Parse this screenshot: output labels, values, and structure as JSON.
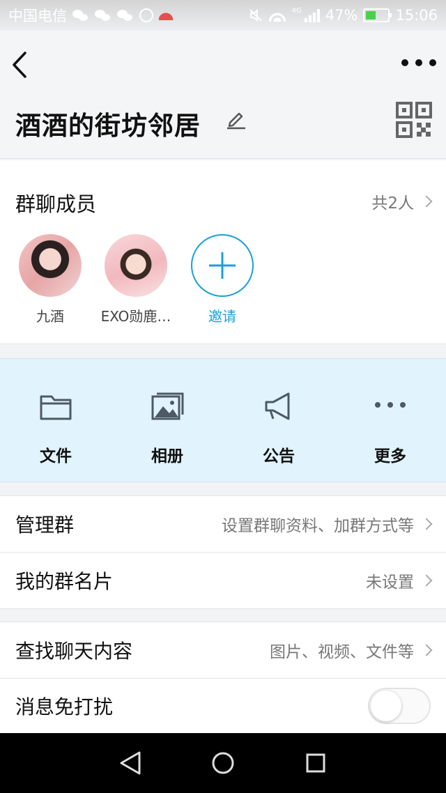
{
  "status_bar": {
    "carrier": "中国电信",
    "network": "4G",
    "battery": "47%",
    "time": "15:06"
  },
  "header": {
    "title": "酒酒的街坊邻居"
  },
  "members": {
    "title": "群聊成员",
    "count": "共2人",
    "list": [
      {
        "name": "九酒"
      },
      {
        "name": "EXO勋鹿…"
      }
    ],
    "invite_label": "邀请"
  },
  "tools": [
    {
      "label": "文件",
      "icon": "folder-icon"
    },
    {
      "label": "相册",
      "icon": "album-icon"
    },
    {
      "label": "公告",
      "icon": "announcement-icon"
    },
    {
      "label": "更多",
      "icon": "more-dots-icon"
    }
  ],
  "settings": {
    "manage": {
      "label": "管理群",
      "value": "设置群聊资料、加群方式等"
    },
    "card": {
      "label": "我的群名片",
      "value": "未设置"
    },
    "search": {
      "label": "查找聊天内容",
      "value": "图片、视频、文件等"
    },
    "dnd": {
      "label": "消息免打扰",
      "enabled": false
    }
  },
  "colors": {
    "accent": "#1aa0d8",
    "tools_bg": "#e1f3fc"
  }
}
